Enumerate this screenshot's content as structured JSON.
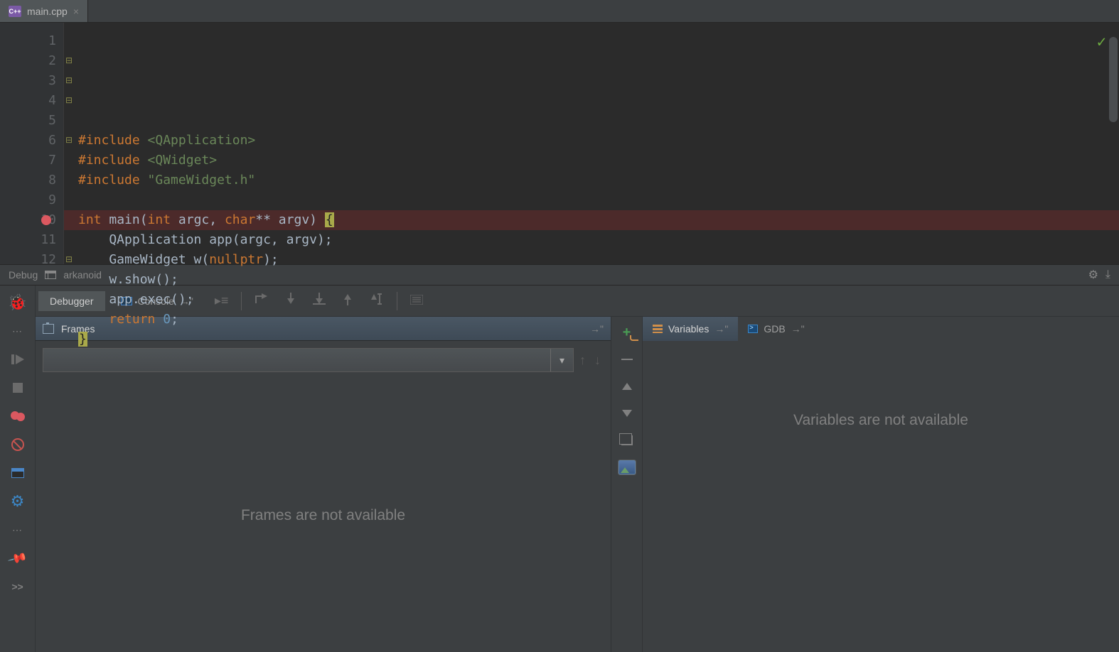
{
  "editor": {
    "tab_name": "main.cpp",
    "line_numbers": [
      "1",
      "2",
      "3",
      "4",
      "5",
      "6",
      "7",
      "8",
      "9",
      "10",
      "11",
      "12"
    ],
    "breakpoint_line": 10,
    "code_tokens": [
      [],
      [
        {
          "t": "preproc",
          "v": "#include "
        },
        {
          "t": "str",
          "v": "<QApplication>"
        }
      ],
      [
        {
          "t": "preproc",
          "v": "#include "
        },
        {
          "t": "str",
          "v": "<QWidget>"
        }
      ],
      [
        {
          "t": "preproc",
          "v": "#include "
        },
        {
          "t": "str",
          "v": "\"GameWidget.h\""
        }
      ],
      [],
      [
        {
          "t": "kw",
          "v": "int "
        },
        {
          "t": "fn",
          "v": "main("
        },
        {
          "t": "kw",
          "v": "int "
        },
        {
          "t": "fn",
          "v": "argc, "
        },
        {
          "t": "kw",
          "v": "char"
        },
        {
          "t": "fn",
          "v": "** argv) "
        },
        {
          "t": "brhl",
          "v": "{"
        }
      ],
      [
        {
          "t": "fn",
          "v": "    QApplication app(argc, argv);"
        }
      ],
      [
        {
          "t": "fn",
          "v": "    GameWidget w("
        },
        {
          "t": "kw",
          "v": "nullptr"
        },
        {
          "t": "fn",
          "v": ");"
        }
      ],
      [
        {
          "t": "fn",
          "v": "    w.show();"
        }
      ],
      [
        {
          "t": "fn",
          "v": "    app.exec();"
        }
      ],
      [
        {
          "t": "fn",
          "v": "    "
        },
        {
          "t": "kw",
          "v": "return "
        },
        {
          "t": "num",
          "v": "0"
        },
        {
          "t": "fn",
          "v": ";"
        }
      ],
      [
        {
          "t": "brhl",
          "v": "}"
        }
      ]
    ]
  },
  "toolwindow": {
    "title": "Debug",
    "run_config": "arkanoid"
  },
  "debug": {
    "tabs": {
      "debugger": "Debugger",
      "console": "Console"
    },
    "frames": {
      "title": "Frames",
      "empty": "Frames are not available"
    },
    "variables": {
      "tab_vars": "Variables",
      "tab_gdb": "GDB",
      "empty": "Variables are not available"
    }
  },
  "icons": {
    "cpp_badge": "C++",
    "close": "×",
    "check": "✓",
    "popout": "→",
    "gear": "✿",
    "down": "▾",
    "up": "↑",
    "dn": "↓",
    "dl": "⤓",
    "chev": ">>",
    "pin": "📌",
    "plus": "+"
  }
}
